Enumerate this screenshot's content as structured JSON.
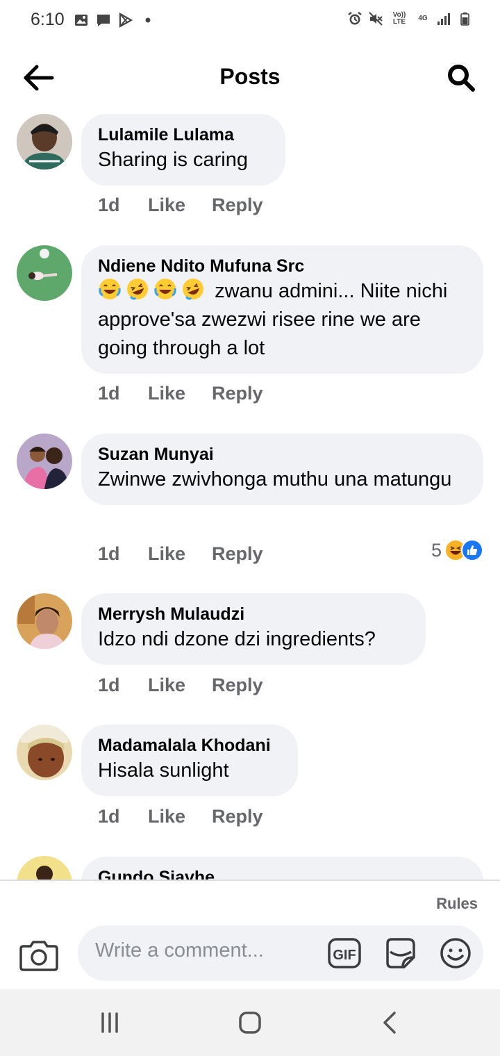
{
  "status_bar": {
    "time": "6:10",
    "volte": "Vo)) LTE",
    "network": "4G"
  },
  "header": {
    "title": "Posts"
  },
  "comments": [
    {
      "author": "Lulamile Lulama",
      "text": "Sharing is caring",
      "time": "1d",
      "like_label": "Like",
      "reply_label": "Reply"
    },
    {
      "author": "Ndiene Ndito Mufuna Src",
      "emoji_prefix": [
        "laughing-tears",
        "rofl",
        "laughing-tears",
        "rofl"
      ],
      "text": "zwanu admini... Niite nichi approve'sa zwezwi risee rine we are going through a lot",
      "time": "1d",
      "like_label": "Like",
      "reply_label": "Reply"
    },
    {
      "author": "Suzan Munyai",
      "text": "Zwinwe zwivhonga muthu una matungu",
      "time": "1d",
      "like_label": "Like",
      "reply_label": "Reply",
      "reaction_count": "5",
      "reactions": [
        "haha",
        "like"
      ]
    },
    {
      "author": "Merrysh Mulaudzi",
      "text": "Idzo ndi dzone dzi ingredients?",
      "time": "1d",
      "like_label": "Like",
      "reply_label": "Reply"
    },
    {
      "author": "Madamalala Khodani",
      "text": "Hisala sunlight",
      "time": "1d",
      "like_label": "Like",
      "reply_label": "Reply"
    },
    {
      "author": "Gundo Siavhe"
    }
  ],
  "composer": {
    "rules_label": "Rules",
    "placeholder": "Write a comment...",
    "gif_label": "GIF"
  },
  "colors": {
    "bubble": "#f0f2f5",
    "meta_text": "#65676b",
    "like_blue": "#1877f2",
    "haha_yellow": "#f7b125"
  }
}
